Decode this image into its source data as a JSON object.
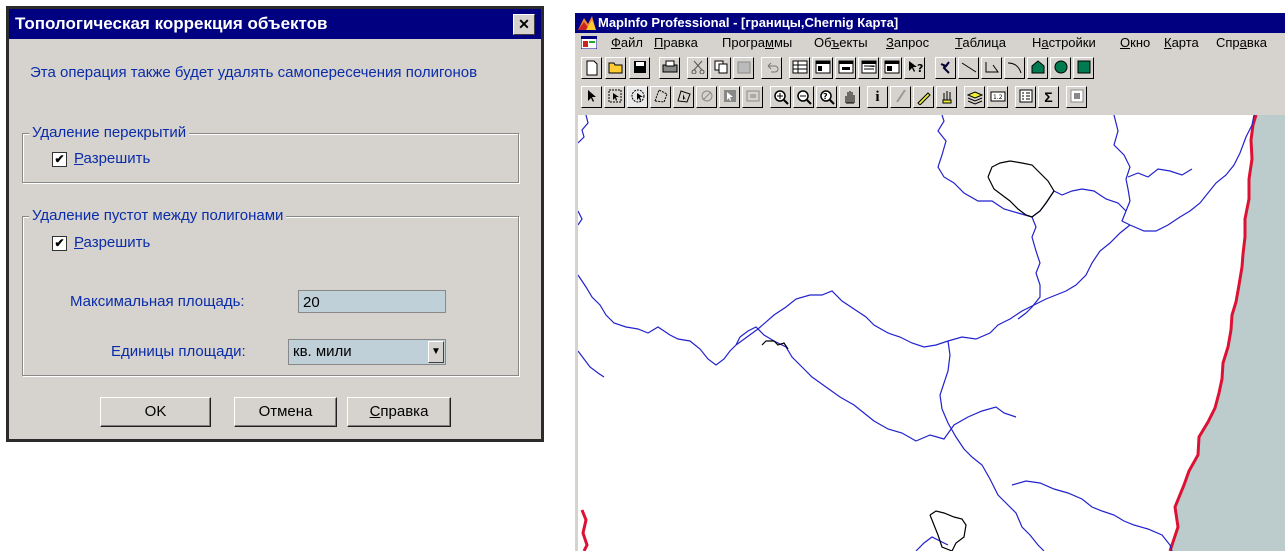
{
  "dialog": {
    "title": "Топологическая коррекция объектов",
    "close_glyph": "✕",
    "description": "Эта операция также будет удалять самопересечения полигонов",
    "overlap_group": {
      "legend": "Удаление перекрытий",
      "allow_checked": true,
      "allow_label_hotkey": "Р",
      "allow_label_rest": "азрешить"
    },
    "gaps_group": {
      "legend": "Удаление пустот между полигонами",
      "allow_checked": true,
      "allow_label_hotkey": "Р",
      "allow_label_rest": "азрешить",
      "max_area_label": "Максимальная площадь:",
      "max_area_value": "20",
      "units_label": "Единицы площади:",
      "units_value": "кв. мили"
    },
    "buttons": {
      "ok": "OK",
      "cancel": "Отмена",
      "help_hotkey": "С",
      "help_rest": "правка"
    }
  },
  "mapinfo": {
    "title": "MapInfo Professional - [границы,Chernig Карта]",
    "menu": [
      {
        "hotkey": "Ф",
        "rest": "айл"
      },
      {
        "hotkey": "П",
        "rest": "равка"
      },
      {
        "pre": "Програ",
        "hotkey": "м",
        "rest": "мы"
      },
      {
        "pre": "Об",
        "hotkey": "ъ",
        "rest": "екты"
      },
      {
        "hotkey": "З",
        "rest": "апрос"
      },
      {
        "hotkey": "Т",
        "rest": "аблица"
      },
      {
        "pre": "Н",
        "hotkey": "а",
        "rest": "стройки"
      },
      {
        "hotkey": "О",
        "rest": "кно"
      },
      {
        "hotkey": "К",
        "rest": "арта"
      },
      {
        "pre": "Спр",
        "hotkey": "а",
        "rest": "вка"
      }
    ],
    "toolbar1_icons": [
      "new-icon",
      "open-icon",
      "save-icon",
      "print-icon",
      "cut-icon",
      "copy-icon",
      "paste-icon",
      "undo-icon",
      "browser-icon",
      "map-icon",
      "graph-icon",
      "layout-icon",
      "redistrict-icon",
      "help-pointer-icon",
      "symbol-icon",
      "line-icon",
      "polyline-icon",
      "arc-icon",
      "polygon-icon",
      "ellipse-icon",
      "rectangle-icon"
    ],
    "toolbar2_icons": [
      "select-icon",
      "marquee-select-icon",
      "radius-select-icon",
      "polygon-select-icon",
      "boundary-select-icon",
      "unselect-icon",
      "invert-select-icon",
      "graph-select-icon",
      "zoom-in-icon",
      "zoom-out-icon",
      "change-view-icon",
      "grabber-icon",
      "info-icon",
      "hotlink-icon",
      "label-icon",
      "drag-window-icon",
      "layer-control-icon",
      "ruler-icon",
      "legend-icon",
      "statistics-icon",
      "clip-icon"
    ],
    "info_glyph": "i",
    "sigma_glyph": "Σ",
    "colors": {
      "boundary": "#2222cc",
      "object": "#000000",
      "border": "#dd1133",
      "outside": "#bccccc"
    }
  }
}
